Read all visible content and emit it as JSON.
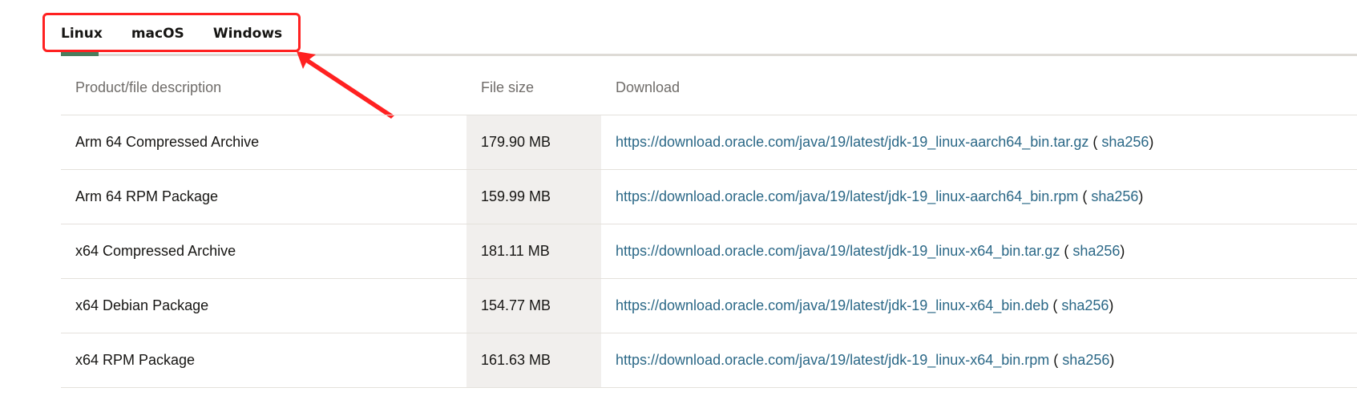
{
  "tabs": [
    {
      "label": "Linux",
      "active": true
    },
    {
      "label": "macOS",
      "active": false
    },
    {
      "label": "Windows",
      "active": false
    }
  ],
  "table": {
    "headers": {
      "description": "Product/file description",
      "size": "File size",
      "download": "Download"
    },
    "rows": [
      {
        "description": "Arm 64 Compressed Archive",
        "size": "179.90 MB",
        "url": "https://download.oracle.com/java/19/latest/jdk-19_linux-aarch64_bin.tar.gz",
        "checksum": "sha256"
      },
      {
        "description": "Arm 64 RPM Package",
        "size": "159.99 MB",
        "url": "https://download.oracle.com/java/19/latest/jdk-19_linux-aarch64_bin.rpm",
        "checksum": "sha256"
      },
      {
        "description": "x64 Compressed Archive",
        "size": "181.11 MB",
        "url": "https://download.oracle.com/java/19/latest/jdk-19_linux-x64_bin.tar.gz",
        "checksum": "sha256"
      },
      {
        "description": "x64 Debian Package",
        "size": "154.77 MB",
        "url": "https://download.oracle.com/java/19/latest/jdk-19_linux-x64_bin.deb",
        "checksum": "sha256"
      },
      {
        "description": "x64 RPM Package",
        "size": "161.63 MB",
        "url": "https://download.oracle.com/java/19/latest/jdk-19_linux-x64_bin.rpm",
        "checksum": "sha256"
      }
    ]
  },
  "colors": {
    "link": "#2b6887",
    "active_tab_indicator": "#4b7d5d",
    "annotation": "#ff2121",
    "size_column_bg": "#f1efed"
  }
}
